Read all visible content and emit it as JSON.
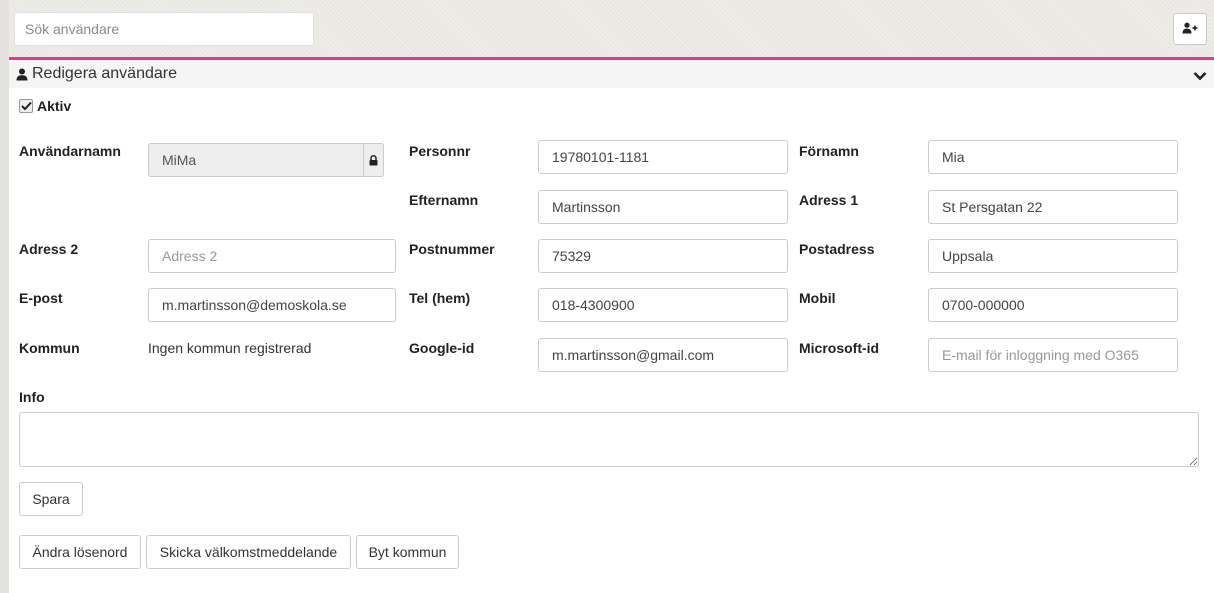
{
  "search": {
    "placeholder": "Sök användare"
  },
  "colors": {
    "accent": "#e8368f"
  },
  "icons": {
    "add_user": "add-user-icon",
    "user": "user-icon",
    "collapse": "chevron-down-icon",
    "lock": "lock-icon",
    "checkbox": "checkmark-icon"
  },
  "panel": {
    "title": "Redigera användare"
  },
  "active": {
    "label": "Aktiv",
    "checked": true
  },
  "form": {
    "username": {
      "label": "Användarnamn",
      "value": "MiMa"
    },
    "personnr": {
      "label": "Personnr",
      "value": "19780101-1181"
    },
    "fornamn": {
      "label": "Förnamn",
      "value": "Mia"
    },
    "efternamn": {
      "label": "Efternamn",
      "value": "Martinsson"
    },
    "adress1": {
      "label": "Adress 1",
      "value": "St Persgatan 22"
    },
    "adress2": {
      "label": "Adress 2",
      "value": "",
      "placeholder": "Adress 2"
    },
    "postnummer": {
      "label": "Postnummer",
      "value": "75329"
    },
    "postadress": {
      "label": "Postadress",
      "value": "Uppsala"
    },
    "epost": {
      "label": "E-post",
      "value": "m.martinsson@demoskola.se"
    },
    "tel_hem": {
      "label": "Tel (hem)",
      "value": "018-4300900"
    },
    "mobil": {
      "label": "Mobil",
      "value": "0700-000000"
    },
    "kommun": {
      "label": "Kommun",
      "value": "Ingen kommun registrerad"
    },
    "google_id": {
      "label": "Google-id",
      "value": "m.martinsson@gmail.com"
    },
    "microsoft_id": {
      "label": "Microsoft-id",
      "value": "",
      "placeholder": "E-mail för inloggning med O365"
    },
    "info": {
      "label": "Info",
      "value": ""
    }
  },
  "buttons": {
    "save": "Spara",
    "change_password": "Ändra lösenord",
    "send_welcome": "Skicka välkomstmeddelande",
    "change_municipality": "Byt kommun"
  }
}
